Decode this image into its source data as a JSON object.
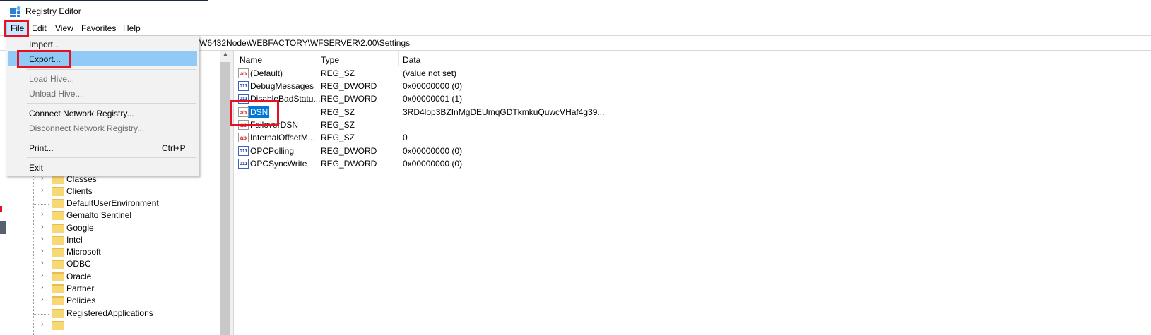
{
  "window": {
    "title": "Registry Editor"
  },
  "menubar": {
    "items": [
      "File",
      "Edit",
      "View",
      "Favorites",
      "Help"
    ]
  },
  "address": {
    "path": "W6432Node\\WEBFACTORY\\WFSERVER\\2.00\\Settings"
  },
  "file_menu": {
    "items": [
      {
        "label": "Import...",
        "enabled": true
      },
      {
        "label": "Export...",
        "enabled": true,
        "highlighted": true
      },
      {
        "label": "Load Hive...",
        "enabled": false
      },
      {
        "label": "Unload Hive...",
        "enabled": false
      },
      {
        "label": "Connect Network Registry...",
        "enabled": true
      },
      {
        "label": "Disconnect Network Registry...",
        "enabled": false
      },
      {
        "label": "Print...",
        "enabled": true,
        "shortcut": "Ctrl+P"
      },
      {
        "label": "Exit",
        "enabled": true
      }
    ]
  },
  "tree": {
    "items": [
      {
        "label": "Classes",
        "expandable": true
      },
      {
        "label": "Clients",
        "expandable": true
      },
      {
        "label": "DefaultUserEnvironment",
        "expandable": false
      },
      {
        "label": "Gemalto Sentinel",
        "expandable": true
      },
      {
        "label": "Google",
        "expandable": true
      },
      {
        "label": "Intel",
        "expandable": true
      },
      {
        "label": "Microsoft",
        "expandable": true
      },
      {
        "label": "ODBC",
        "expandable": true
      },
      {
        "label": "Oracle",
        "expandable": true
      },
      {
        "label": "Partner",
        "expandable": true
      },
      {
        "label": "Policies",
        "expandable": true
      },
      {
        "label": "RegisteredApplications",
        "expandable": false
      }
    ]
  },
  "values_list": {
    "columns": [
      "Name",
      "Type",
      "Data"
    ],
    "rows": [
      {
        "name": "(Default)",
        "type": "REG_SZ",
        "data": "(value not set)",
        "icon": "string-value-icon"
      },
      {
        "name": "DebugMessages",
        "type": "REG_DWORD",
        "data": "0x00000000 (0)",
        "icon": "dword-value-icon"
      },
      {
        "name": "DisableBadStatu...",
        "type": "REG_DWORD",
        "data": "0x00000001 (1)",
        "icon": "dword-value-icon"
      },
      {
        "name": "DSN",
        "type": "REG_SZ",
        "data": "3RD4lop3BZInMgDEUmqGDTkmkuQuwcVHaf4g39...",
        "icon": "string-value-icon",
        "selected": true
      },
      {
        "name": "FailoverDSN",
        "type": "REG_SZ",
        "data": "",
        "icon": "string-value-icon"
      },
      {
        "name": "InternalOffsetM...",
        "type": "REG_SZ",
        "data": "0",
        "icon": "string-value-icon"
      },
      {
        "name": "OPCPolling",
        "type": "REG_DWORD",
        "data": "0x00000000 (0)",
        "icon": "dword-value-icon"
      },
      {
        "name": "OPCSyncWrite",
        "type": "REG_DWORD",
        "data": "0x00000000 (0)",
        "icon": "dword-value-icon"
      }
    ]
  },
  "icon_glyphs": {
    "string": "ab",
    "dword": "011"
  },
  "colors": {
    "annotation_red": "#e81123",
    "selection_blue": "#0078d7",
    "menu_highlight": "#91c9f7"
  }
}
